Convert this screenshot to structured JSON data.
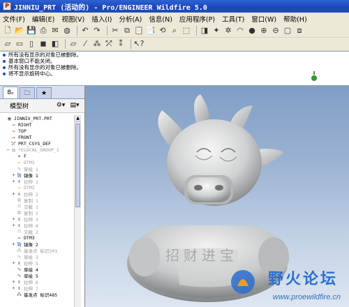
{
  "window": {
    "title": "JINNIU_PRT (活动的) - Pro/ENGINEER Wildfire 5.0"
  },
  "menu": [
    {
      "label": "文件(F)"
    },
    {
      "label": "编辑(E)"
    },
    {
      "label": "视图(V)"
    },
    {
      "label": "插入(I)"
    },
    {
      "label": "分析(A)"
    },
    {
      "label": "信息(N)"
    },
    {
      "label": "应用程序(P)"
    },
    {
      "label": "工具(T)"
    },
    {
      "label": "窗口(W)"
    },
    {
      "label": "帮助(H)"
    }
  ],
  "messages": [
    "所有没有显示的对象已被删除。",
    "基本窗口不能关闭。",
    "所有没有显示的对象已被删除。",
    "将不显示旋转中心。"
  ],
  "nav": {
    "tree_title": "模型树"
  },
  "tree": [
    {
      "label": "JINNIU_PRT.PRT",
      "icon": "part-icon",
      "dim": false,
      "expand": ""
    },
    {
      "label": "RIGHT",
      "icon": "datum-plane-icon",
      "dim": false,
      "expand": ""
    },
    {
      "label": "TOP",
      "icon": "datum-plane-icon",
      "dim": false,
      "expand": ""
    },
    {
      "label": "FRONT",
      "icon": "datum-plane-icon",
      "dim": false,
      "expand": ""
    },
    {
      "label": "PRT_CSYS_DEF",
      "icon": "csys-icon",
      "dim": false,
      "expand": ""
    },
    {
      "label": "*ELOCAL_GROUP_1",
      "icon": "group-icon",
      "dim": true,
      "expand": "−"
    },
    {
      "label": "F",
      "icon": "point-icon",
      "dim": false,
      "expand": ""
    },
    {
      "label": "DTM1",
      "icon": "datum-plane-icon",
      "dim": true,
      "expand": ""
    },
    {
      "label": "草绘 1",
      "icon": "sketch-icon",
      "dim": true,
      "expand": ""
    },
    {
      "label": "镜像 1",
      "icon": "mirror-icon",
      "dim": false,
      "expand": "+"
    },
    {
      "label": "拉伸 1",
      "icon": "extrude-icon",
      "dim": true,
      "expand": "+"
    },
    {
      "label": "DTM2",
      "icon": "datum-plane-icon",
      "dim": true,
      "expand": ""
    },
    {
      "label": "拉伸 2",
      "icon": "extrude-icon",
      "dim": true,
      "expand": "+"
    },
    {
      "label": "复制 1",
      "icon": "copy-icon",
      "dim": true,
      "expand": ""
    },
    {
      "label": "交截 1",
      "icon": "intersect-icon",
      "dim": true,
      "expand": ""
    },
    {
      "label": "复制 2",
      "icon": "copy-icon",
      "dim": true,
      "expand": ""
    },
    {
      "label": "拉伸 3",
      "icon": "extrude-icon",
      "dim": true,
      "expand": "+"
    },
    {
      "label": "拉伸 4",
      "icon": "extrude-icon",
      "dim": true,
      "expand": "+"
    },
    {
      "label": "交截 2",
      "icon": "intersect-icon",
      "dim": true,
      "expand": ""
    },
    {
      "label": "DTM3",
      "icon": "datum-plane-icon",
      "dim": false,
      "expand": ""
    },
    {
      "label": "镜像 2",
      "icon": "mirror-icon",
      "dim": false,
      "expand": "+"
    },
    {
      "label": "基准点 标识301",
      "icon": "datum-point-icon",
      "dim": true,
      "expand": ""
    },
    {
      "label": "草绘 3",
      "icon": "sketch-icon",
      "dim": true,
      "expand": ""
    },
    {
      "label": "拉伸 5",
      "icon": "extrude-icon",
      "dim": true,
      "expand": "+"
    },
    {
      "label": "草绘 4",
      "icon": "sketch-icon",
      "dim": false,
      "expand": ""
    },
    {
      "label": "草绘 5",
      "icon": "sketch-icon",
      "dim": false,
      "expand": ""
    },
    {
      "label": "拉伸 6",
      "icon": "extrude-icon",
      "dim": true,
      "expand": "+"
    },
    {
      "label": "拉伸 7",
      "icon": "extrude-icon",
      "dim": true,
      "expand": "+"
    },
    {
      "label": "基准点 标识485",
      "icon": "datum-point-icon",
      "dim": false,
      "expand": ""
    }
  ],
  "model": {
    "chest_text": "招财进宝"
  },
  "watermark": {
    "text": "野火论坛",
    "url": "www.proewildfire.cn"
  },
  "colors": {
    "title_bar": "#1f4dbd",
    "model_surface": "#cfd0d0",
    "viewport_top": "#7f9ec6"
  }
}
